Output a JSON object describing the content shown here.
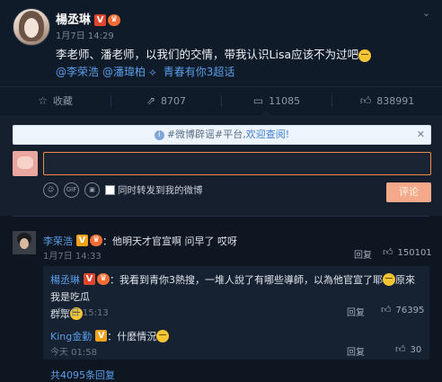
{
  "post": {
    "author": "楊丞琳",
    "verified_badge": "V",
    "time": "1月7日 14:29",
    "content": "李老师、潘老师，以我们的交情，带我认识Lisa应该不为过吧",
    "mentions": [
      "@李荣浩",
      "@潘瑋柏"
    ],
    "supertopic": "青春有你3超话"
  },
  "actions": {
    "favorite": "收藏",
    "repost_count": "8707",
    "comment_count": "11085",
    "like_count": "838991"
  },
  "notice": {
    "prefix": "#微博辟谣#平台,",
    "link": "欢迎查阅!"
  },
  "composer": {
    "forward_label": "同时转发到我的微博",
    "submit_label": "评论"
  },
  "comment": {
    "author": "李荣浩",
    "text": "：他明天才官宣啊 问早了 哎呀",
    "time": "1月7日 14:33",
    "reply_label": "回复",
    "likes": "150101"
  },
  "replies": [
    {
      "author": "楊丞琳",
      "text_line1": "：我看到青你3熱搜，一堆人說了有哪些導師，以為他官宣了耶",
      "text_line1_tail": "原來我是吃瓜",
      "text_line2": "群眾",
      "time": "1月7日 15:13",
      "reply_label": "回复",
      "likes": "76395"
    },
    {
      "author": "King金勤",
      "text": "：什麼情況",
      "time": "今天 01:58",
      "reply_label": "回复",
      "likes": "30"
    }
  ],
  "more_replies": "共4095条回复",
  "colors": {
    "background": "#0e1622",
    "link": "#5b9ee8",
    "accent": "#f08a4b",
    "verified": "#e0462e"
  }
}
